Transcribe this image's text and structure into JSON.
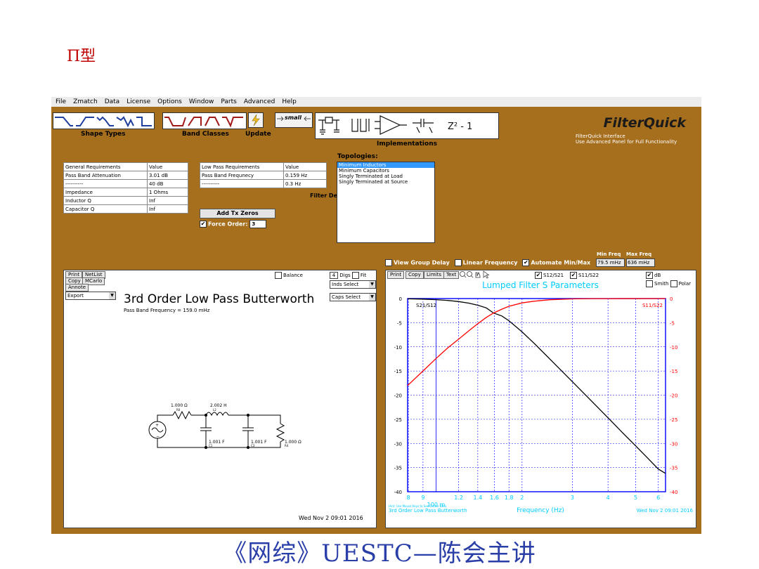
{
  "slide": {
    "heading": "Π型",
    "footer": "《网综》UESTC—陈会主讲"
  },
  "menu": [
    "File",
    "Zmatch",
    "Data",
    "License",
    "Options",
    "Window",
    "Parts",
    "Advanced",
    "Help"
  ],
  "toolbar": {
    "shape_types": "Shape Types",
    "band_classes": "Band Classes",
    "update": "Update",
    "small": "small",
    "implementations": "Implementations",
    "z_label": "Z² - 1"
  },
  "brand": {
    "title": "FilterQuick",
    "line1": "FilterQuick Interface",
    "line2": "Use Advanced Panel for Full Functionality"
  },
  "general": {
    "headers": [
      "General Requirements",
      "Value"
    ],
    "rows": [
      [
        "Pass Band Attenuation",
        "3.01 dB"
      ],
      [
        "----------",
        "40 dB"
      ],
      [
        "Impedance",
        "1 Ohms"
      ],
      [
        "Inductor Q",
        "Inf"
      ],
      [
        "Capacitor Q",
        "Inf"
      ]
    ]
  },
  "lowpass": {
    "headers": [
      "Low Pass Requirements",
      "Value"
    ],
    "rows": [
      [
        "Pass Band Frequnecy",
        "0.159 Hz"
      ],
      [
        "----------",
        "0.3 Hz"
      ]
    ],
    "overlap_text": "Filter De"
  },
  "add_tx_zeros": "Add Tx Zeros",
  "force_order": {
    "label": "Force Order:",
    "value": "3",
    "checked": true
  },
  "topologies": {
    "title": "Topologies:",
    "items": [
      "Minimum Inductors",
      "Minimum Capacitors",
      "Singly Terminated at Load",
      "Singly Terminated at Source"
    ],
    "selected_index": 0
  },
  "options": {
    "view_group_delay": "View Group Delay",
    "linear_frequency": "Linear Frequency",
    "automate_minmax": "Automate Min/Max",
    "min_freq_label": "Min Freq",
    "max_freq_label": "Max Freq",
    "min_freq": "79.5 mHz",
    "max_freq": "636 mHz"
  },
  "schematic_panel": {
    "print": "Print",
    "netlist": "NetList",
    "copy": "Copy",
    "mcarlo": "MCarlo",
    "annote": "Annote",
    "export": "Export",
    "balance": "Balance",
    "digs_value": "4",
    "digs": "Digs",
    "fit": "Fit",
    "inds_select": "Inds Select",
    "caps_select": "Caps Select",
    "title": "3rd Order Low Pass Butterworth",
    "subtitle": "Pass Band Frequency = 159.0 mHz",
    "date": "Wed Nov  2 09:01 2016",
    "components": {
      "r0_val": "1.000 Ω",
      "r0": "R0",
      "l2_val": "2.002 H",
      "l2": "L2",
      "c1_val": "1.001 F",
      "c1": "C1",
      "c3_val": "1.001 F",
      "c3": "C3",
      "r4_val": "1.000 Ω",
      "r4": "R4"
    }
  },
  "plot_panel": {
    "buttons": [
      "Print",
      "Copy",
      "Limits",
      "Text"
    ],
    "s12_label": "S12/S21",
    "s11_label": "S11/S22",
    "db_label": "dB",
    "smith": "Smith",
    "polar": "Polar",
    "hint": "Hint: Use Mouse Keys to See Cursor Data",
    "footer_title": "3rd Order Low Pass Butterworth",
    "footer_date": "Wed Nov  2 09:01 2016"
  },
  "chart_data": {
    "type": "line",
    "title": "Lumped Filter S Parameters",
    "xlabel": "Frequency (Hz)",
    "x_scale": "log",
    "xlim": [
      0.0795,
      0.636
    ],
    "ylim": [
      -40,
      0
    ],
    "x_ticks": [
      {
        "v": 0.08,
        "t": "8"
      },
      {
        "v": 0.09,
        "t": "9"
      },
      {
        "v": 0.12,
        "t": "1.2"
      },
      {
        "v": 0.14,
        "t": "1.4"
      },
      {
        "v": 0.16,
        "t": "1.6"
      },
      {
        "v": 0.18,
        "t": "1.8"
      },
      {
        "v": 0.2,
        "t": "2"
      },
      {
        "v": 0.3,
        "t": "3"
      },
      {
        "v": 0.4,
        "t": "4"
      },
      {
        "v": 0.5,
        "t": "5"
      },
      {
        "v": 0.6,
        "t": "6"
      }
    ],
    "x_sub_label": "100 m",
    "y_ticks": [
      0,
      -5,
      -10,
      -15,
      -20,
      -25,
      -30,
      -35,
      -40
    ],
    "grid": true,
    "colors": {
      "s21": "#000000",
      "s11": "#ff0000",
      "axis_text": "#0000ff",
      "accent": "#00ccff"
    },
    "series": [
      {
        "name": "S21/S12",
        "x": [
          0.0795,
          0.09,
          0.1,
          0.11,
          0.12,
          0.13,
          0.14,
          0.15,
          0.159,
          0.17,
          0.18,
          0.2,
          0.22,
          0.25,
          0.3,
          0.35,
          0.4,
          0.45,
          0.5,
          0.55,
          0.6,
          0.636
        ],
        "values": [
          -0.06,
          -0.12,
          -0.23,
          -0.39,
          -0.62,
          -0.95,
          -1.38,
          -1.94,
          -3.0,
          -3.6,
          -4.6,
          -6.9,
          -9.2,
          -12.5,
          -17.2,
          -21.2,
          -24.7,
          -27.8,
          -30.5,
          -33.0,
          -35.3,
          -36.2
        ]
      },
      {
        "name": "S11/S22",
        "x": [
          0.0795,
          0.09,
          0.1,
          0.11,
          0.12,
          0.13,
          0.14,
          0.15,
          0.159,
          0.17,
          0.18,
          0.2,
          0.22,
          0.25,
          0.3,
          0.35,
          0.4,
          0.636
        ],
        "values": [
          -18.0,
          -15.0,
          -12.4,
          -10.2,
          -8.4,
          -6.7,
          -5.2,
          -3.9,
          -3.0,
          -2.2,
          -1.6,
          -0.9,
          -0.55,
          -0.25,
          -0.07,
          -0.02,
          -0.01,
          0.0
        ]
      }
    ]
  }
}
